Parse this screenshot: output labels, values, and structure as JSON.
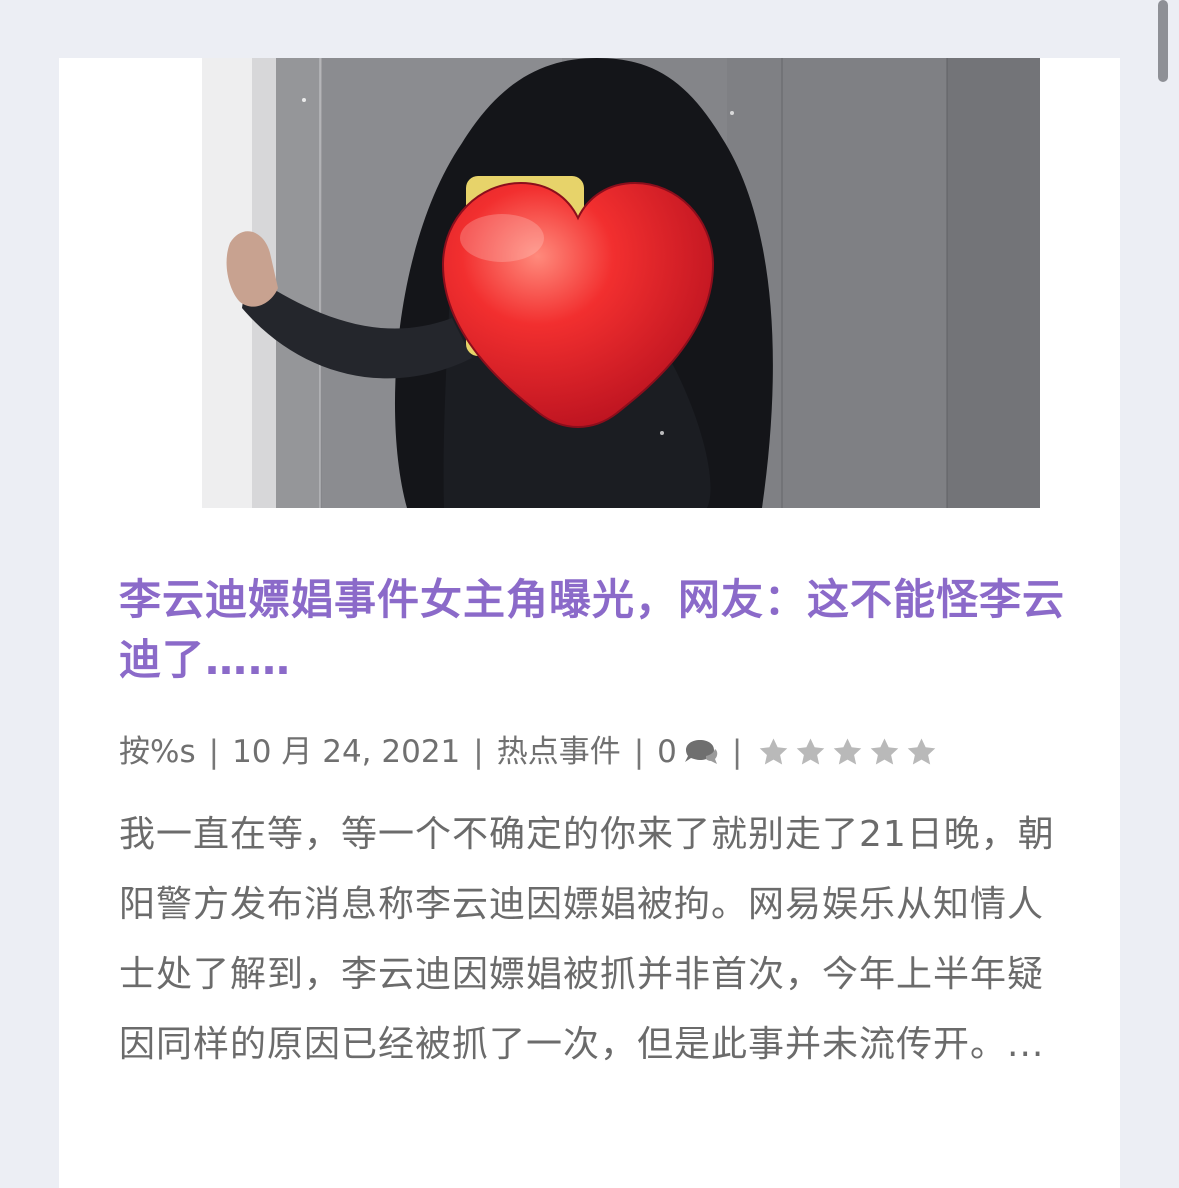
{
  "post": {
    "title": "李云迪嫖娼事件女主角曝光，网友：这不能怪李云迪了……",
    "meta": {
      "author": "按%s",
      "separator": "|",
      "date": "10 月 24, 2021",
      "category": "热点事件",
      "comments": "0",
      "rating": 0,
      "rating_max": 5
    },
    "excerpt": "我一直在等，等一个不确定的你来了就别走了21日晚，朝阳警方发布消息称李云迪因嫖娼被拘。网易娱乐从知情人士处了解到，李云迪因嫖娼被抓并非首次，今年上半年疑因同样的原因已经被抓了一次，但是此事并未流传开。..."
  },
  "icons": {
    "comment": "comment-bubble-icon",
    "star": "star-icon",
    "heart": "heart-emoji-icon"
  },
  "colors": {
    "background": "#eceef4",
    "card": "#ffffff",
    "title": "#8b6ac9",
    "meta": "#707070",
    "excerpt": "#6b6b6b",
    "star": "#b9b9b9"
  }
}
